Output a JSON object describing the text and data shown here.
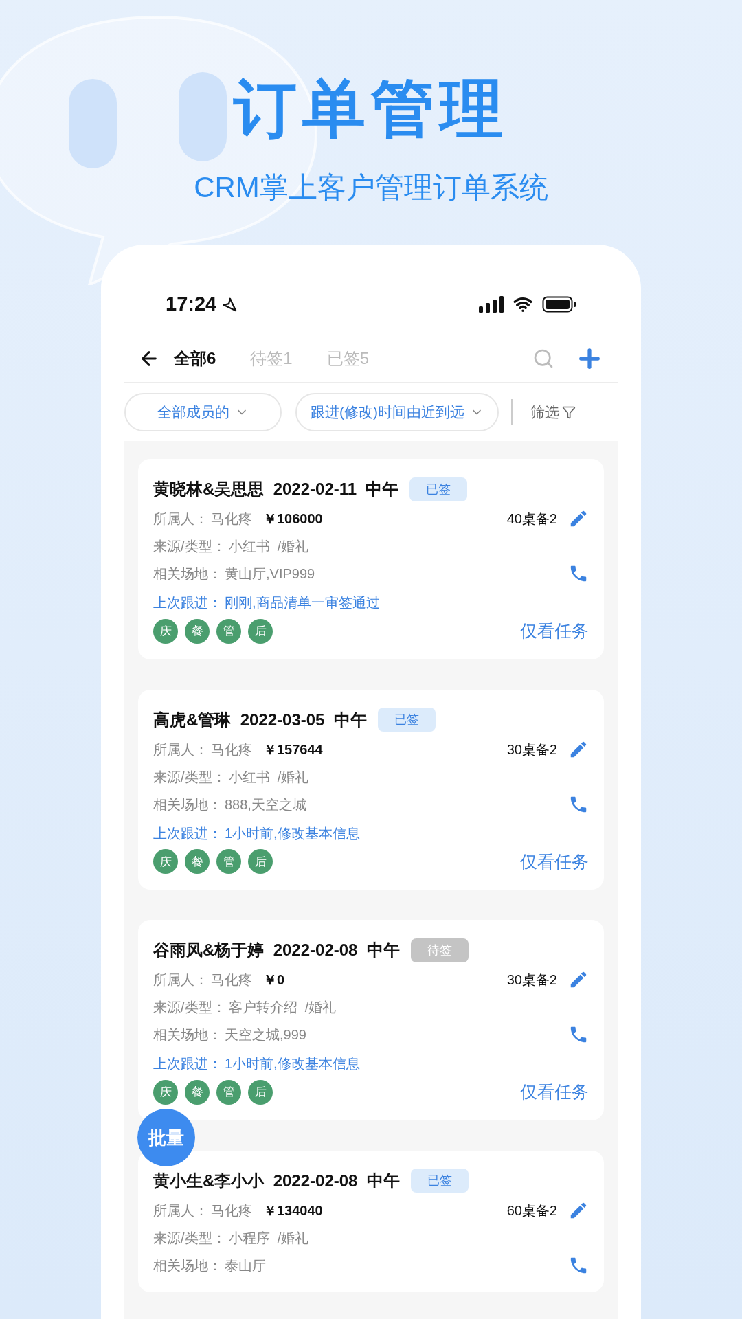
{
  "headline": {
    "title": "订单管理",
    "subtitle": "CRM掌上客户管理订单系统"
  },
  "status_bar": {
    "time": "17:24"
  },
  "tabs": [
    {
      "label": "全部6",
      "selected": true
    },
    {
      "label": "待签1",
      "selected": false
    },
    {
      "label": "已签5",
      "selected": false
    }
  ],
  "filters": {
    "members": "全部成员的",
    "sort": "跟进(修改)时间由近到远",
    "filter": "筛选"
  },
  "orders": [
    {
      "title": "黄晓林&吴思思  2022-02-11  中午",
      "status": {
        "label": "已签",
        "kind": "signed"
      },
      "owner_label": "所属人：",
      "owner": "马化疼",
      "amount": "￥106000",
      "tables": "40桌备2",
      "source_label": "来源/类型：",
      "source": "小红书  /婚礼",
      "venue_label": "相关场地：",
      "venue": "黄山厅,VIP999",
      "followup_label": "上次跟进：",
      "followup": "刚刚,商品清单一审签通过",
      "tags": [
        "庆",
        "餐",
        "管",
        "后"
      ],
      "task_link": "仅看任务"
    },
    {
      "title": "高虎&管琳  2022-03-05  中午",
      "status": {
        "label": "已签",
        "kind": "signed"
      },
      "owner_label": "所属人：",
      "owner": "马化疼",
      "amount": "￥157644",
      "tables": "30桌备2",
      "source_label": "来源/类型：",
      "source": "小红书  /婚礼",
      "venue_label": "相关场地：",
      "venue": "888,天空之城",
      "followup_label": "上次跟进：",
      "followup": "1小时前,修改基本信息",
      "tags": [
        "庆",
        "餐",
        "管",
        "后"
      ],
      "task_link": "仅看任务"
    },
    {
      "title": "谷雨风&杨于婷  2022-02-08  中午",
      "status": {
        "label": "待签",
        "kind": "pending"
      },
      "owner_label": "所属人：",
      "owner": "马化疼",
      "amount": "￥0",
      "tables": "30桌备2",
      "source_label": "来源/类型：",
      "source": "客户转介绍  /婚礼",
      "venue_label": "相关场地：",
      "venue": "天空之城,999",
      "followup_label": "上次跟进：",
      "followup": "1小时前,修改基本信息",
      "tags": [
        "庆",
        "餐",
        "管",
        "后"
      ],
      "task_link": "仅看任务"
    },
    {
      "title": "黄小生&李小小  2022-02-08  中午",
      "status": {
        "label": "已签",
        "kind": "signed"
      },
      "owner_label": "所属人：",
      "owner": "马化疼",
      "amount": "￥134040",
      "tables": "60桌备2",
      "source_label": "来源/类型：",
      "source": "小程序  /婚礼",
      "venue_label": "相关场地：",
      "venue": "泰山厅"
    }
  ],
  "batch_button": "批量"
}
